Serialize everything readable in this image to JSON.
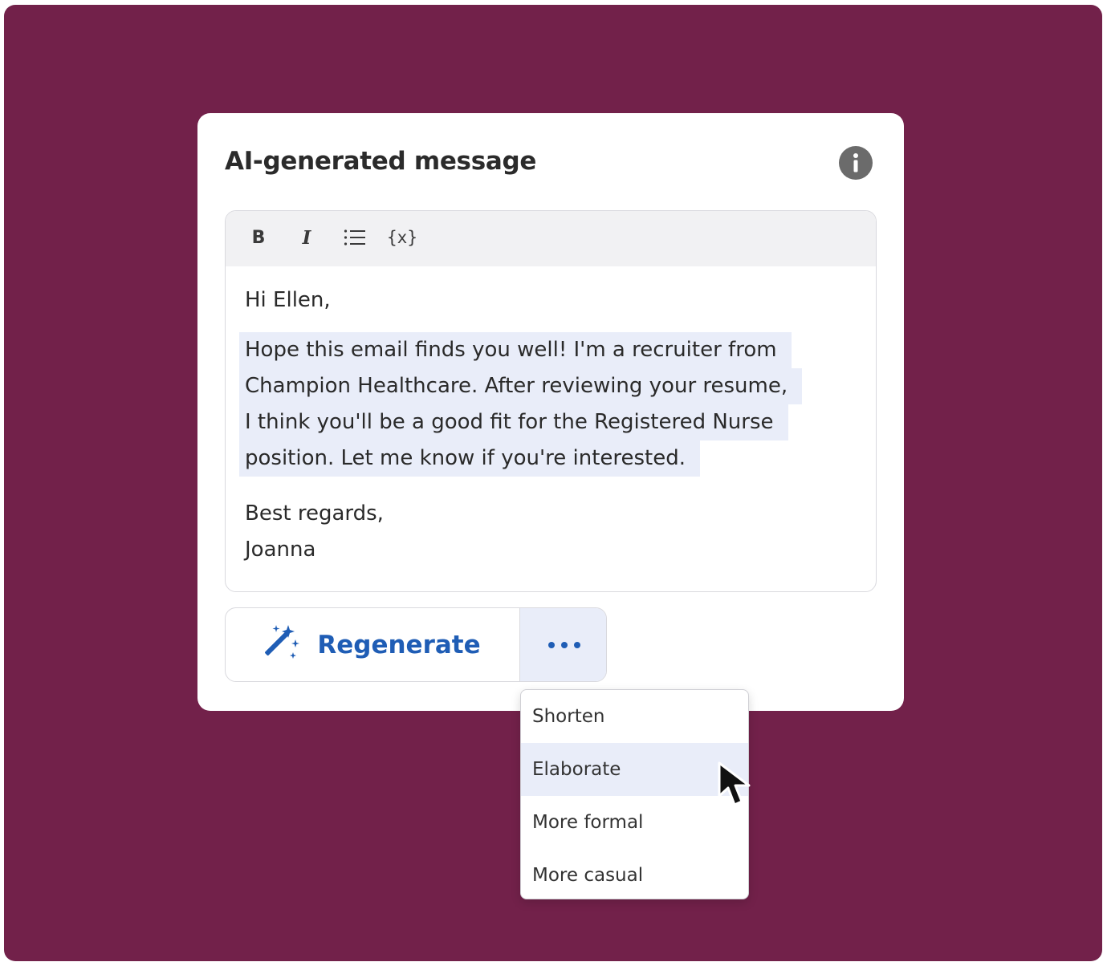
{
  "card": {
    "title": "AI-generated message"
  },
  "icons": {
    "info": "info-icon",
    "bold": "bold-icon",
    "italic": "italic-icon",
    "list": "bulleted-list-icon",
    "variable": "variable-icon",
    "regenerate": "magic-wand-icon",
    "more": "more-dots-icon",
    "cursor": "mouse-pointer-icon"
  },
  "toolbar": {
    "bold_label": "B",
    "italic_label": "I",
    "variable_label": "{x}"
  },
  "message": {
    "greeting": "Hi Ellen,",
    "highlighted_lines": [
      "Hope this email finds you well! I'm a recruiter from",
      "Champion Healthcare. After reviewing your resume,",
      "I think you'll be a good fit for the Registered Nurse",
      "position. Let me know if you're interested."
    ],
    "signoff": "Best regards,",
    "signature": "Joanna"
  },
  "actions": {
    "regenerate_label": "Regenerate"
  },
  "menu": {
    "items": [
      "Shorten",
      "Elaborate",
      "More formal",
      "More casual"
    ],
    "hovered": "Elaborate"
  },
  "colors": {
    "backdrop": "#72214a",
    "accent": "#1f5db5",
    "highlight": "#e9edf9",
    "info_icon": "#6b6b6b"
  }
}
